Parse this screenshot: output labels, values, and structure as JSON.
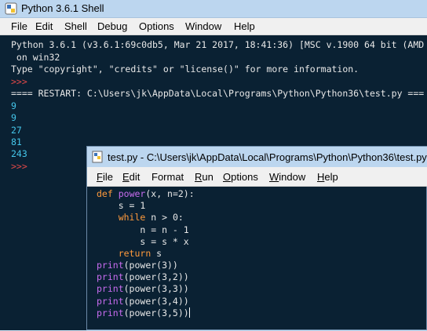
{
  "shell": {
    "title": "Python 3.6.1 Shell",
    "menu": [
      "File",
      "Edit",
      "Shell",
      "Debug",
      "Options",
      "Window",
      "Help"
    ],
    "console_lines": [
      {
        "text": "Python 3.6.1 (v3.6.1:69c0db5, Mar 21 2017, 18:41:36) [MSC v.1900 64 bit (AMD",
        "kind": "out"
      },
      {
        "text": " on win32",
        "kind": "out"
      },
      {
        "text": "Type \"copyright\", \"credits\" or \"license()\" for more information.",
        "kind": "out"
      },
      {
        "text": ">>> ",
        "kind": "prompt"
      },
      {
        "text": "==== RESTART: C:\\Users\\jk\\AppData\\Local\\Programs\\Python\\Python36\\test.py ===",
        "kind": "out"
      },
      {
        "text": "9",
        "kind": "stdout"
      },
      {
        "text": "9",
        "kind": "stdout"
      },
      {
        "text": "27",
        "kind": "stdout"
      },
      {
        "text": "81",
        "kind": "stdout"
      },
      {
        "text": "243",
        "kind": "stdout"
      },
      {
        "text": ">>> ",
        "kind": "prompt"
      }
    ]
  },
  "editor": {
    "title": "test.py - C:\\Users\\jk\\AppData\\Local\\Programs\\Python\\Python36\\test.py",
    "menu": [
      {
        "label": "File",
        "underline": "F",
        "rest": "ile"
      },
      {
        "label": "Edit",
        "underline": "E",
        "rest": "dit"
      },
      {
        "label": "Format",
        "underline": "",
        "rest": "Format"
      },
      {
        "label": "Run",
        "underline": "R",
        "rest": "un"
      },
      {
        "label": "Options",
        "underline": "O",
        "rest": "ptions"
      },
      {
        "label": "Window",
        "underline": "W",
        "rest": "indow"
      },
      {
        "label": "Help",
        "underline": "H",
        "rest": "elp"
      }
    ],
    "code": {
      "l1_kw": "def",
      "l1_name": "power",
      "l1_rest": "(x, n=2):",
      "l2": "    s = 1",
      "l3_indent": "    ",
      "l3_kw": "while",
      "l3_rest": " n > 0:",
      "l4": "        n = n - 1",
      "l5": "        s = s * x",
      "l6_indent": "    ",
      "l6_kw": "return",
      "l6_rest": " s",
      "calls": [
        {
          "fn": "print",
          "args": "(power(3))"
        },
        {
          "fn": "print",
          "args": "(power(3,2))"
        },
        {
          "fn": "print",
          "args": "(power(3,3))"
        },
        {
          "fn": "print",
          "args": "(power(3,4))"
        },
        {
          "fn": "print",
          "args": "(power(3,5))"
        }
      ]
    }
  },
  "colors": {
    "console_bg": "#0a2133",
    "keyword": "#ff9a3c",
    "builtin": "#c86cf0",
    "prompt": "#e04848",
    "stdout": "#45c6ea"
  },
  "icons": [
    "python-idle-icon"
  ]
}
